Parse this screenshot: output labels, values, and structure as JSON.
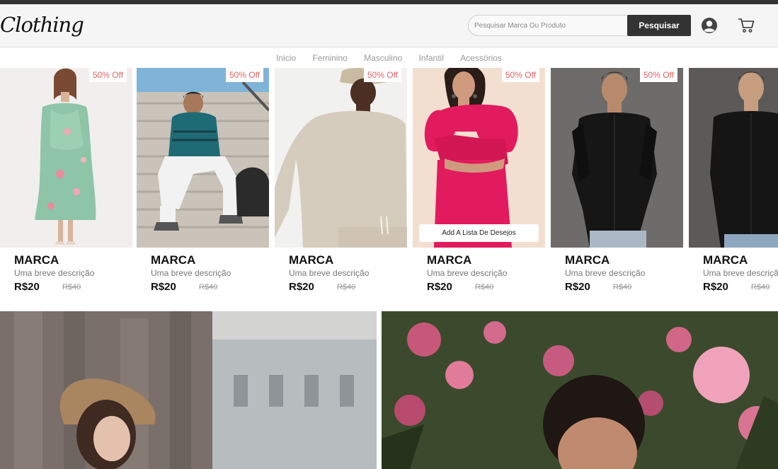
{
  "header": {
    "logo": "Clothing",
    "search": {
      "placeholder": "Pesquisar Marca Ou Produto",
      "button": "Pesquisar"
    },
    "icons": [
      "user-icon",
      "cart-icon"
    ]
  },
  "nav": {
    "items": [
      "Inicio",
      "Feminino",
      "Masculino",
      "Infantil",
      "Acessórios"
    ]
  },
  "products": [
    {
      "badge": "50% Off",
      "brand": "MARCA",
      "desc": "Uma breve descrição",
      "price": "R$20",
      "old_price": "R$40"
    },
    {
      "badge": "50% Off",
      "brand": "MARCA",
      "desc": "Uma breve descrição",
      "price": "R$20",
      "old_price": "R$40"
    },
    {
      "badge": "50% Off",
      "brand": "MARCA",
      "desc": "Uma breve descrição",
      "price": "R$20",
      "old_price": "R$40"
    },
    {
      "badge": "50% Off",
      "brand": "MARCA",
      "desc": "Uma breve descrição",
      "price": "R$20",
      "old_price": "R$40",
      "wishlist": "Add A Lista De Desejos"
    },
    {
      "badge": "50% Off",
      "brand": "MARCA",
      "desc": "Uma breve descrição",
      "price": "R$20",
      "old_price": "R$40"
    },
    {
      "brand": "MARCA",
      "desc": "Uma breve descrição",
      "price": "R$20",
      "old_price": "R$40"
    }
  ],
  "colors": {
    "topbar": "#333333",
    "badge_text": "#e06262",
    "button": "#333333"
  }
}
